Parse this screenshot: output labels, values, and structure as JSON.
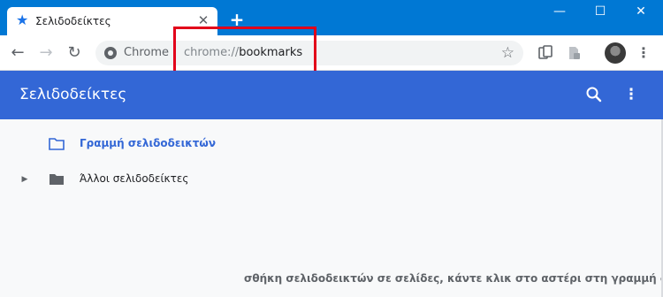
{
  "tab": {
    "title": "Σελιδοδείκτες",
    "close": "✕",
    "new_tab": "+"
  },
  "window_controls": {
    "minimize": "—",
    "maximize": "☐",
    "close": "✕"
  },
  "toolbar": {
    "back": "←",
    "forward": "→",
    "reload": "↻",
    "site_chip": "Chrome",
    "url_scheme": "chrome://",
    "url_host": "bookmarks",
    "star": "☆",
    "menu": "⋮"
  },
  "app": {
    "title": "Σελιδοδείκτες",
    "more": "⋮"
  },
  "folders": [
    {
      "label": "Γραμμή σελιδοδεικτών",
      "selected": true,
      "expandable": false
    },
    {
      "label": "Άλλοι σελιδοδείκτες",
      "selected": false,
      "expandable": true
    }
  ],
  "empty_message": "σθήκη σελιδοδεικτών σε σελίδες, κάντε κλικ στο αστέρι στη γραμμή διευ",
  "colors": {
    "titlebar": "#0078d4",
    "appbar": "#3367d6",
    "highlight": "#e2001a",
    "accent": "#1a73e8"
  }
}
